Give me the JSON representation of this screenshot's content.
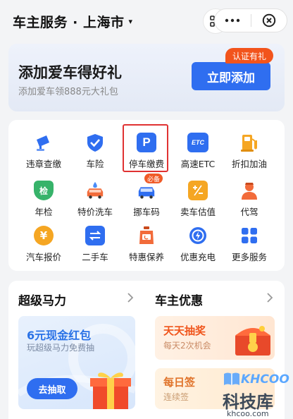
{
  "header": {
    "title": "车主服务 · 上海市",
    "caret": "▾"
  },
  "banner": {
    "title": "添加爱车得好礼",
    "subtitle": "添加爱车领888元大礼包",
    "button": "立即添加",
    "badge": "认证有礼"
  },
  "services": [
    {
      "label": "违章查缴",
      "icon": "camera-icon"
    },
    {
      "label": "车险",
      "icon": "shield-check-icon"
    },
    {
      "label": "停车缴费",
      "icon": "parking-icon",
      "icon_text": "P"
    },
    {
      "label": "高速ETC",
      "icon": "etc-icon",
      "icon_text": "ETC"
    },
    {
      "label": "折扣加油",
      "icon": "fuel-pump-icon"
    },
    {
      "label": "年检",
      "icon": "inspection-icon",
      "icon_text": "检"
    },
    {
      "label": "特价洗车",
      "icon": "car-wash-icon"
    },
    {
      "label": "挪车码",
      "icon": "move-car-icon",
      "tag": "必备"
    },
    {
      "label": "卖车估值",
      "icon": "calculator-icon"
    },
    {
      "label": "代驾",
      "icon": "driver-icon"
    },
    {
      "label": "汽车报价",
      "icon": "price-icon",
      "icon_text": "¥"
    },
    {
      "label": "二手车",
      "icon": "used-car-icon"
    },
    {
      "label": "特惠保养",
      "icon": "oil-can-icon"
    },
    {
      "label": "优惠充电",
      "icon": "charging-icon"
    },
    {
      "label": "更多服务",
      "icon": "grid-icon"
    }
  ],
  "sections": {
    "left": {
      "title": "超级马力",
      "promo_title": "6元现金红包",
      "promo_sub": "玩超级马力免费抽",
      "promo_button": "去抽取"
    },
    "right": {
      "title": "车主优惠",
      "promo1_title": "天天抽奖",
      "promo1_sub": "每天2次机会",
      "promo2_title": "每日签",
      "promo2_sub": "连续签"
    }
  },
  "watermark": {
    "brand": "KHCOO",
    "cn": "科技库",
    "url": "khcoo.com"
  },
  "colors": {
    "accent": "#2f6ef0",
    "badge": "#f2541c",
    "highlight": "#e03232"
  }
}
